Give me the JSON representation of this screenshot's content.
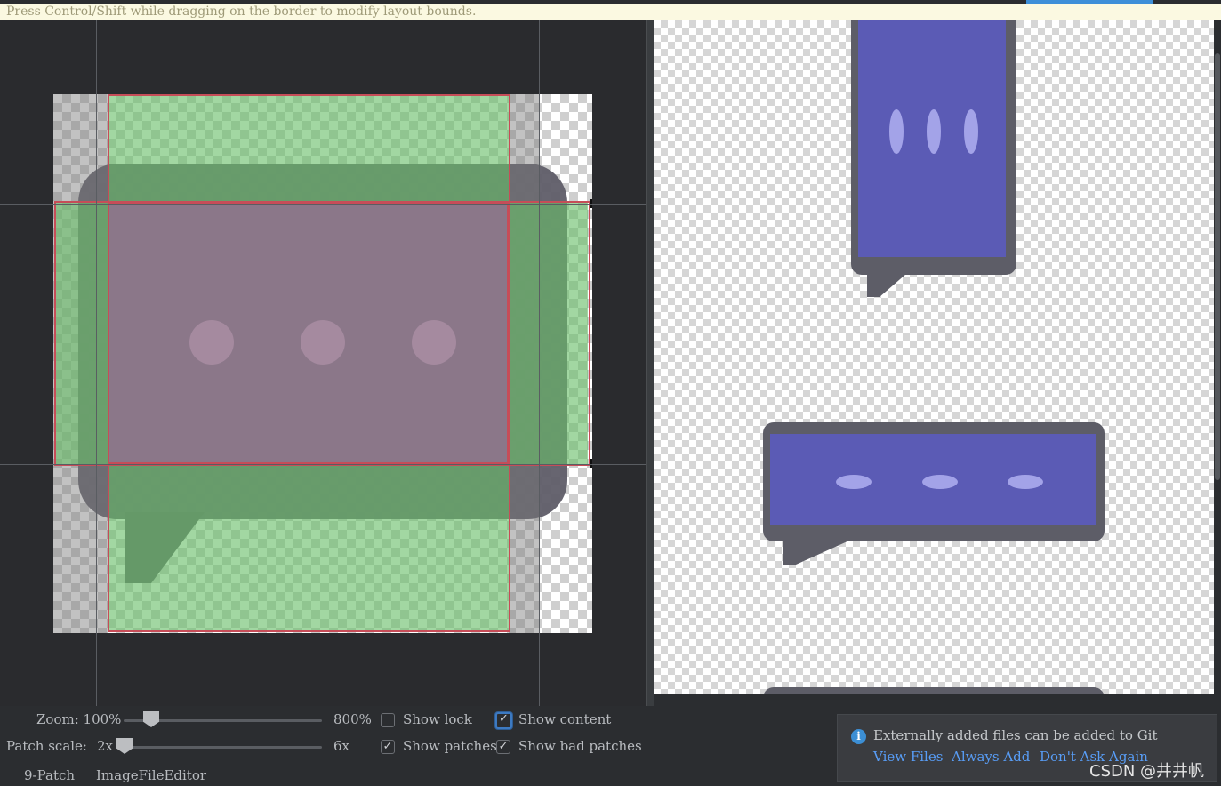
{
  "hint_bar": {
    "text": "Press Control/Shift while dragging on the border to modify layout bounds."
  },
  "controls": {
    "zoom_label": "Zoom: 100%",
    "zoom_max": "800%",
    "zoom_level": 100,
    "patch_scale_label": "Patch scale:",
    "patch_scale_min": "2x",
    "patch_scale_max": "6x",
    "patch_scale_value": 2,
    "show_lock": {
      "label": "Show lock",
      "checked": false
    },
    "show_content": {
      "label": "Show content",
      "checked": true
    },
    "show_patches": {
      "label": "Show patches",
      "checked": true
    },
    "show_bad_patches": {
      "label": "Show bad patches",
      "checked": true
    }
  },
  "tabs": [
    "9-Patch",
    "ImageFileEditor"
  ],
  "notification": {
    "message": "Externally added files can be added to Git",
    "links": [
      "View Files",
      "Always Add",
      "Don't Ask Again"
    ]
  },
  "watermark": "CSDN @井井帆",
  "colors": {
    "accent": "#3d8fd8",
    "patch_green": "#69be69",
    "patch_border": "#c64d58",
    "preview_bubble": "#5b5bb5",
    "link": "#589df6"
  },
  "icons": {
    "info": "info-icon",
    "check": "checkmark-icon"
  }
}
